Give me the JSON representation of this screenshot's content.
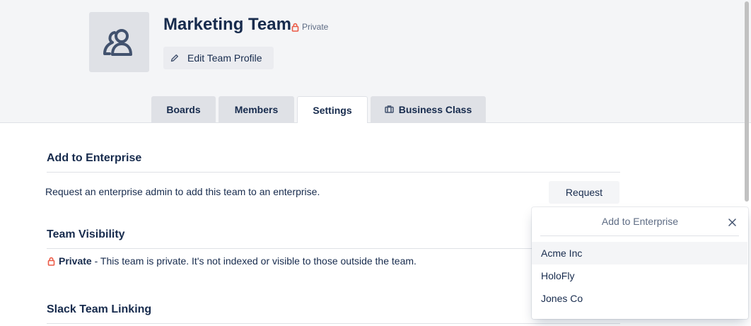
{
  "team": {
    "name": "Marketing Team",
    "privacy_label": "Private",
    "edit_label": "Edit Team Profile"
  },
  "tabs": [
    {
      "label": "Boards",
      "active": false
    },
    {
      "label": "Members",
      "active": false
    },
    {
      "label": "Settings",
      "active": true
    },
    {
      "label": "Business Class",
      "active": false,
      "icon": "briefcase-icon"
    }
  ],
  "sections": {
    "enterprise": {
      "title": "Add to Enterprise",
      "description": "Request an enterprise admin to add this team to an enterprise.",
      "button_label": "Request"
    },
    "visibility": {
      "title": "Team Visibility",
      "status": "Private",
      "description": " - This team is private. It's not indexed or visible to those outside the team."
    },
    "slack": {
      "title": "Slack Team Linking"
    }
  },
  "popover": {
    "title": "Add to Enterprise",
    "items": [
      "Acme Inc",
      "HoloFly",
      "Jones Co"
    ]
  },
  "colors": {
    "text": "#172b4d",
    "muted": "#5e6c84",
    "lock_red": "#eb5a46",
    "header_bg": "#f4f5f7",
    "tab_bg": "#dfe1e6"
  }
}
